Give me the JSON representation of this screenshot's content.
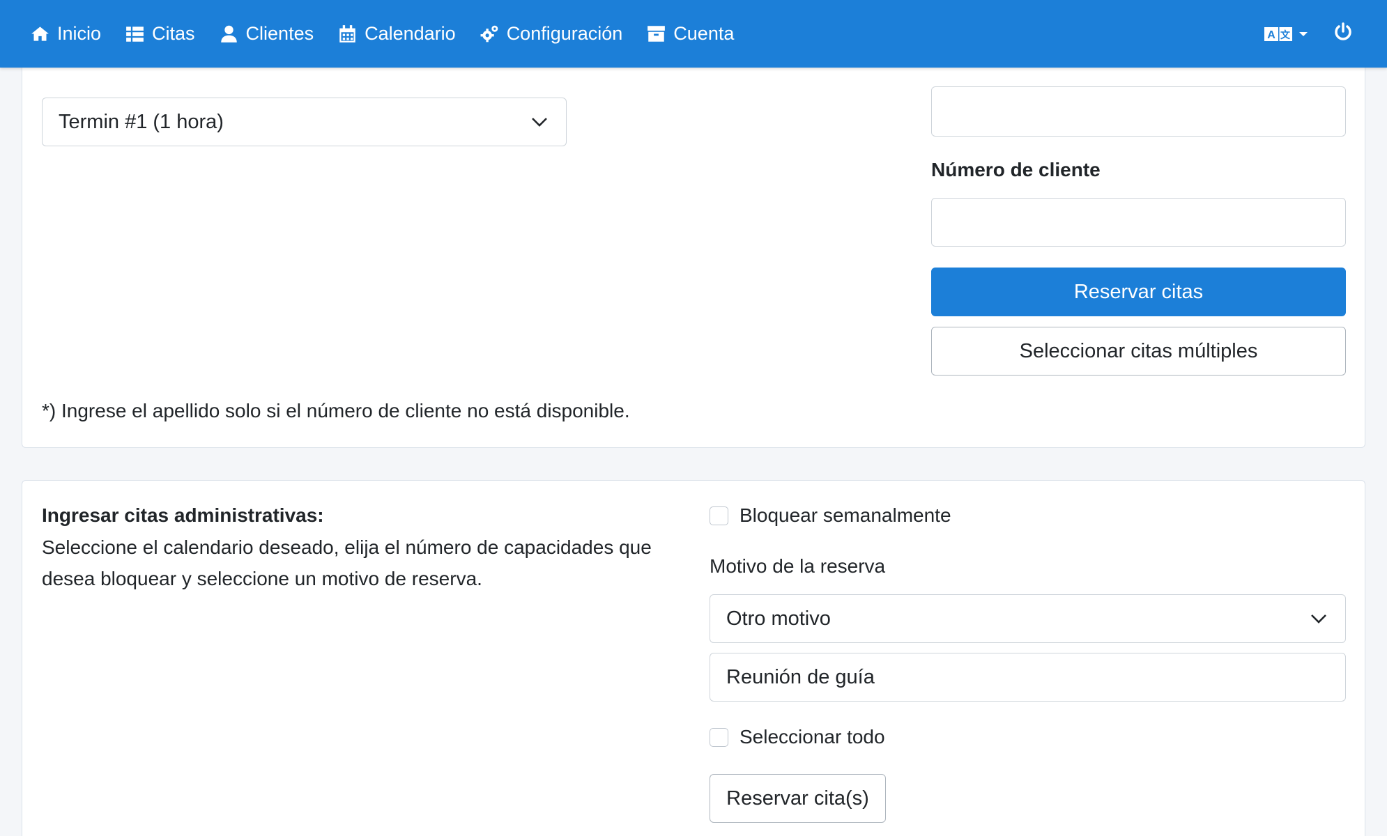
{
  "nav": {
    "items": [
      {
        "label": "Inicio",
        "icon": "home-icon"
      },
      {
        "label": "Citas",
        "icon": "list-icon"
      },
      {
        "label": "Clientes",
        "icon": "user-icon"
      },
      {
        "label": "Calendario",
        "icon": "calendar-icon"
      },
      {
        "label": "Configuración",
        "icon": "cogs-icon"
      },
      {
        "label": "Cuenta",
        "icon": "archive-icon"
      }
    ],
    "language_icon": "language-icon",
    "power_icon": "power-icon",
    "background": "#1c7fd8"
  },
  "booking": {
    "appointment_select": "Termin #1 (1 hora)",
    "lastname_value": "",
    "customer_number_label": "Número de cliente",
    "customer_number_value": "",
    "reserve_button": "Reservar citas",
    "multi_button": "Seleccionar citas múltiples",
    "footnote": "*) Ingrese el apellido solo si el número de cliente no está disponible."
  },
  "admin": {
    "title": "Ingresar citas administrativas:",
    "description": "Seleccione el calendario deseado, elija el número de capacidades que desea bloquear y seleccione un motivo de reserva.",
    "weekly_block_label": "Bloquear semanalmente",
    "reason_label": "Motivo de la reserva",
    "reason_select": "Otro motivo",
    "reason_text": "Reunión de guía",
    "select_all_label": "Seleccionar todo",
    "reserve_button": "Reservar cita(s)"
  }
}
